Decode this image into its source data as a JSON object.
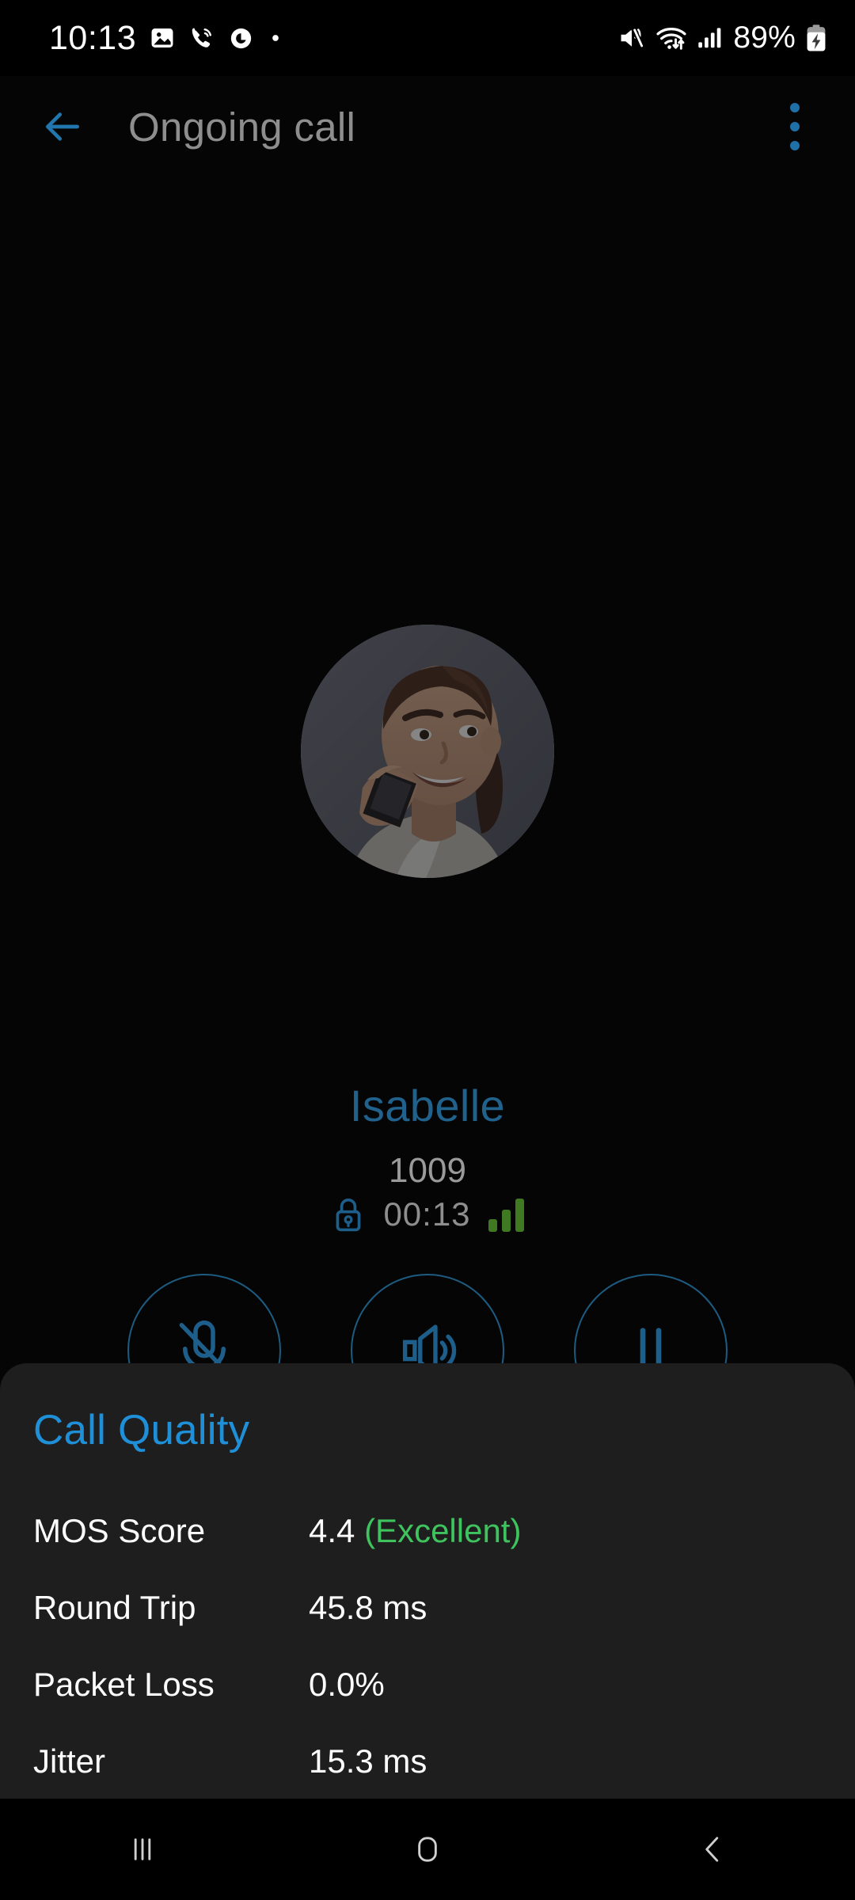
{
  "status_bar": {
    "time": "10:13",
    "battery_percent": "89%",
    "icons": [
      "gallery-icon",
      "call-waves-icon",
      "circle-g-icon",
      "dot-icon",
      "mute-vibrate-icon",
      "wifi-transfer-icon",
      "cellular-signal-icon",
      "battery-charging-icon"
    ]
  },
  "app_bar": {
    "title": "Ongoing call",
    "back_icon": "back-arrow-icon",
    "menu_icon": "overflow-menu-icon"
  },
  "call": {
    "contact_name": "Isabelle",
    "extension": "1009",
    "duration": "00:13",
    "encrypted_icon": "lock-icon",
    "quality_bars_icon": "signal-bars-icon",
    "avatar_alt": "contact-photo"
  },
  "controls": {
    "row1": [
      {
        "label": "Mute",
        "icon": "microphone-muted-icon"
      },
      {
        "label": "Speaker",
        "icon": "speaker-icon"
      },
      {
        "label": "Hold",
        "icon": "pause-icon"
      }
    ],
    "row2": [
      {
        "label": "",
        "icon": "control-icon-4"
      },
      {
        "label": "",
        "icon": "control-icon-5"
      },
      {
        "label": "",
        "icon": "control-icon-6"
      }
    ]
  },
  "call_quality": {
    "title": "Call Quality",
    "metrics": [
      {
        "label": "MOS Score",
        "value": "4.4",
        "tag": "(Excellent)"
      },
      {
        "label": "Round Trip",
        "value": "45.8 ms",
        "tag": ""
      },
      {
        "label": "Packet Loss",
        "value": "0.0%",
        "tag": ""
      },
      {
        "label": "Jitter",
        "value": "15.3 ms",
        "tag": ""
      }
    ]
  },
  "nav_bar": {
    "recents_label": "recents-icon",
    "home_label": "home-icon",
    "back_label": "back-icon"
  },
  "colors": {
    "accent_blue": "#1f90d8",
    "dim_blue": "#20628c",
    "good_green": "#3fc35e",
    "sheet_bg": "#1e1e1e",
    "page_bg": "#050505"
  }
}
